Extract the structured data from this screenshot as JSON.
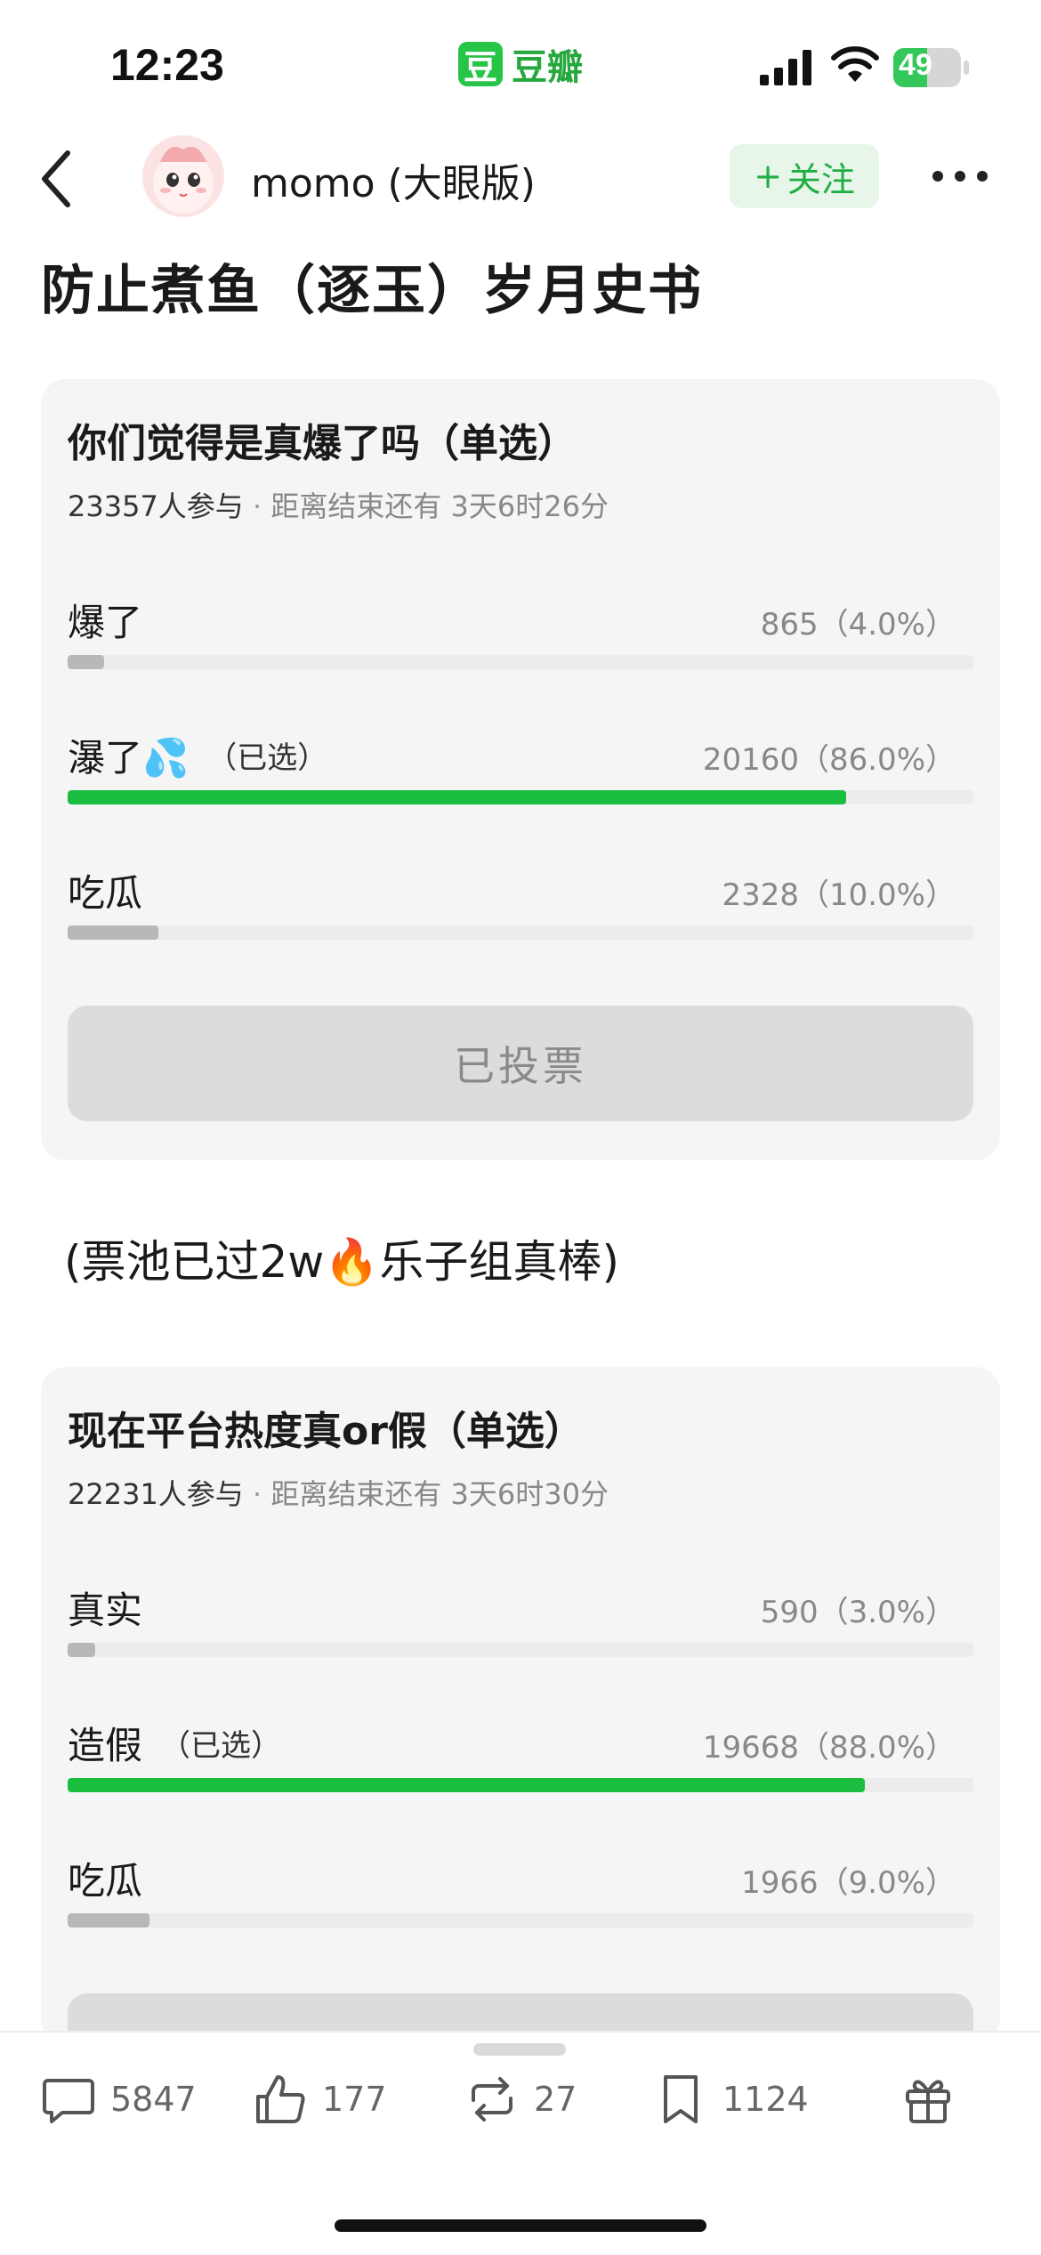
{
  "status_bar": {
    "time": "12:23",
    "app_logo": "豆",
    "app_name": "豆瓣",
    "battery": "49"
  },
  "nav": {
    "author": "momo (大眼版)",
    "follow_label": "关注",
    "follow_plus": "+"
  },
  "title": "防止煮鱼（逐玉）岁月史书",
  "polls": [
    {
      "question": "你们觉得是真爆了吗（单选）",
      "participants": "23357人参与",
      "separator": "·",
      "deadline": "距离结束还有 3天6时26分",
      "options": [
        {
          "label": "爆了",
          "count": "865（4.0%）",
          "percent": 4.0,
          "selected": false
        },
        {
          "label": "瀑了💦",
          "selected_tag": "（已选）",
          "count": "20160（86.0%）",
          "percent": 86.0,
          "selected": true
        },
        {
          "label": "吃瓜",
          "count": "2328（10.0%）",
          "percent": 10.0,
          "selected": false
        }
      ],
      "button_label": "已投票"
    },
    {
      "question": "现在平台热度真or假（单选）",
      "participants": "22231人参与",
      "separator": "·",
      "deadline": "距离结束还有 3天6时30分",
      "options": [
        {
          "label": "真实",
          "count": "590（3.0%）",
          "percent": 3.0,
          "selected": false
        },
        {
          "label": "造假",
          "selected_tag": "（已选）",
          "count": "19668（88.0%）",
          "percent": 88.0,
          "selected": true
        },
        {
          "label": "吃瓜",
          "count": "1966（9.0%）",
          "percent": 9.0,
          "selected": false
        }
      ]
    }
  ],
  "middle_text": "(票池已过2w🔥乐子组真棒)",
  "bottom_bar": {
    "comments": "5847",
    "likes": "177",
    "reshares": "27",
    "collects": "1124"
  },
  "icons": [
    "back-icon",
    "more-icon",
    "comment-icon",
    "thumbs-up-icon",
    "reshare-icon",
    "bookmark-icon",
    "gift-icon"
  ],
  "colors": {
    "accent": "#1bbd40",
    "follow_bg": "#e8f6ea",
    "card_bg": "#f5f5f5"
  }
}
